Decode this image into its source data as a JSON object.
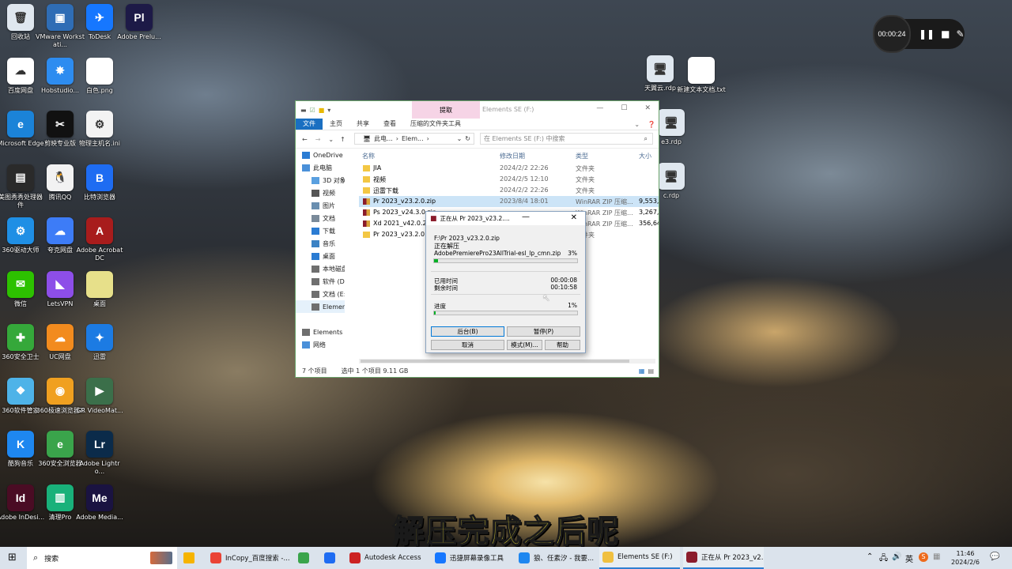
{
  "desktop_icons": [
    {
      "label": "回收站",
      "color": "#dfe7ef",
      "glyph": "🗑"
    },
    {
      "label": "VMware Workstati...",
      "color": "#2f6db5",
      "glyph": "▣"
    },
    {
      "label": "ToDesk",
      "color": "#1677ff",
      "glyph": "✈"
    },
    {
      "label": "Adobe Prelu...",
      "color": "#1d1a47",
      "glyph": "Pl"
    },
    {
      "label": "百度网盘",
      "color": "#ffffff",
      "glyph": "☁"
    },
    {
      "label": "Hobstudio...",
      "color": "#2d8cf0",
      "glyph": "✸"
    },
    {
      "label": "白色.png",
      "color": "#ffffff",
      "glyph": ""
    },
    {
      "label": "Microsoft Edge",
      "color": "#1b83d8",
      "glyph": "e"
    },
    {
      "label": "剪映专业版",
      "color": "#111111",
      "glyph": "✂"
    },
    {
      "label": "物理主机名.ini",
      "color": "#f3f3f3",
      "glyph": "⚙"
    },
    {
      "label": "美图秀秀处理器件",
      "color": "#2a2a2a",
      "glyph": "▤"
    },
    {
      "label": "腾讯QQ",
      "color": "#f2f2f2",
      "glyph": "🐧"
    },
    {
      "label": "比特浏览器",
      "color": "#1e6cf2",
      "glyph": "B"
    },
    {
      "label": "360驱动大师",
      "color": "#1f8fe5",
      "glyph": "⚙"
    },
    {
      "label": "夸克网盘",
      "color": "#3d7cf7",
      "glyph": "☁"
    },
    {
      "label": "Adobe Acrobat DC",
      "color": "#a81c1c",
      "glyph": "A"
    },
    {
      "label": "微信",
      "color": "#2dc100",
      "glyph": "✉"
    },
    {
      "label": "LetsVPN",
      "color": "#8d4ee8",
      "glyph": "◣"
    },
    {
      "label": "桌面",
      "color": "#e7e08a",
      "glyph": ""
    },
    {
      "label": "360安全卫士",
      "color": "#35a83a",
      "glyph": "✚"
    },
    {
      "label": "UC网盘",
      "color": "#f28b1e",
      "glyph": "☁"
    },
    {
      "label": "迅雷",
      "color": "#1c7be3",
      "glyph": "✦"
    },
    {
      "label": "360软件管家",
      "color": "#4eb3e8",
      "glyph": "❖"
    },
    {
      "label": "360极速浏览器X",
      "color": "#f0a020",
      "glyph": "◉"
    },
    {
      "label": "GR VideoMat...",
      "color": "#3b6f4a",
      "glyph": "▶"
    },
    {
      "label": "酷狗音乐",
      "color": "#1e87f0",
      "glyph": "K"
    },
    {
      "label": "360安全浏览器",
      "color": "#3aa44b",
      "glyph": "e"
    },
    {
      "label": "Adobe Lightro...",
      "color": "#0b2b4a",
      "glyph": "Lr"
    },
    {
      "label": "Adobe InDesi...",
      "color": "#4a0c24",
      "glyph": "Id"
    },
    {
      "label": "清理Pro",
      "color": "#19b17a",
      "glyph": "▥"
    },
    {
      "label": "Adobe Media...",
      "color": "#1a1341",
      "glyph": "Me"
    },
    {
      "label": "天翼云.rdp",
      "color": "#dfe7ef",
      "glyph": "🖥"
    },
    {
      "label": "新建文本文档.txt",
      "color": "#ffffff",
      "glyph": ""
    }
  ],
  "partial_icons": [
    {
      "label": "e3.rdp"
    },
    {
      "label": "c.rdp"
    }
  ],
  "recorder": {
    "time": "00:00:24",
    "pause": "❚❚",
    "stop": "■",
    "edit": "✎"
  },
  "explorer": {
    "context_tab": "提取",
    "title": "Elements SE (F:)",
    "ribbon_tabs": [
      "文件",
      "主页",
      "共享",
      "查看",
      "压缩的文件夹工具"
    ],
    "address": [
      "此电...",
      "Elem..."
    ],
    "search_placeholder": "在 Elements SE (F:) 中搜索",
    "nav": [
      {
        "label": "OneDrive",
        "type": "cloud"
      },
      {
        "label": "此电脑",
        "type": "pc"
      },
      {
        "label": "3D 对象",
        "type": "cube"
      },
      {
        "label": "视频",
        "type": "video"
      },
      {
        "label": "图片",
        "type": "pic"
      },
      {
        "label": "文档",
        "type": "doc"
      },
      {
        "label": "下载",
        "type": "down"
      },
      {
        "label": "音乐",
        "type": "music"
      },
      {
        "label": "桌面",
        "type": "desk"
      },
      {
        "label": "本地磁盘",
        "type": "disk"
      },
      {
        "label": "软件 (D:)",
        "type": "disk"
      },
      {
        "label": "文档 (E:)",
        "type": "disk"
      },
      {
        "label": "Elements SE (F:)",
        "type": "disk"
      },
      {
        "label": "",
        "type": "gap"
      },
      {
        "label": "Elements SE",
        "type": "disk"
      },
      {
        "label": "网络",
        "type": "net"
      }
    ],
    "columns": [
      "名称",
      "修改日期",
      "类型",
      "大小"
    ],
    "files": [
      {
        "name": "JIA",
        "date": "2024/2/2 22:26",
        "type": "文件夹",
        "size": "",
        "kind": "folder"
      },
      {
        "name": "视频",
        "date": "2024/2/5 12:10",
        "type": "文件夹",
        "size": "",
        "kind": "folder"
      },
      {
        "name": "迅雷下载",
        "date": "2024/2/2 22:26",
        "type": "文件夹",
        "size": "",
        "kind": "folder"
      },
      {
        "name": "Pr 2023_v23.2.0.zip",
        "date": "2023/8/4 18:01",
        "type": "WinRAR ZIP 压缩...",
        "size": "9,553,1",
        "kind": "zip",
        "selected": true
      },
      {
        "name": "Ps 2023_v24.3.0.zip",
        "date": "",
        "type": "WinRAR ZIP 压缩...",
        "size": "3,267,",
        "kind": "zip"
      },
      {
        "name": "Xd 2021_v42.0.22",
        "date": "",
        "type": "WinRAR ZIP 压缩...",
        "size": "356,64",
        "kind": "zip"
      },
      {
        "name": "Pr 2023_v23.2.0",
        "date": "",
        "type": "文件夹",
        "size": "",
        "kind": "folder"
      }
    ],
    "status_count": "7 个项目",
    "status_selected": "选中 1 个项目  9.11 GB"
  },
  "dialog": {
    "title": "正在从 Pr 2023_v23.2....",
    "archive_path": "F:\\Pr 2023_v23.2.0.zip",
    "action": "正在解压",
    "current_file": "AdobePremierePro23AllTrial-esl_lp_cmn.zip",
    "file_percent": "3%",
    "file_progress": 0.03,
    "elapsed_label": "已用时间",
    "elapsed": "00:00:08",
    "remaining_label": "剩余时间",
    "remaining": "00:10:58",
    "progress_label": "进度",
    "total_percent": "1%",
    "total_progress": 0.01,
    "buttons": {
      "background": "后台(B)",
      "pause": "暂停(P)",
      "cancel": "取消",
      "mode": "模式(M)...",
      "help": "帮助"
    }
  },
  "subtitle": "解压完成之后呢",
  "taskbar": {
    "search": "搜索",
    "items": [
      {
        "label": "InCopy_百度搜索 -...",
        "color": "#ea4335"
      },
      {
        "label": "",
        "color": "#3aa44b"
      },
      {
        "label": "",
        "color": "#1e6cf2"
      },
      {
        "label": "Autodesk Access",
        "color": "#c22"
      },
      {
        "label": "迅捷屏幕录像工具",
        "color": "#1677ff"
      },
      {
        "label": "狼、任素汐 - 我要...",
        "color": "#1e87f0"
      },
      {
        "label": "Elements SE (F:)",
        "color": "#f0c040"
      },
      {
        "label": "正在从 Pr 2023_v2...",
        "color": "#8b1c2c"
      }
    ],
    "lang": "英",
    "time": "11:46",
    "date": "2024/2/6"
  }
}
